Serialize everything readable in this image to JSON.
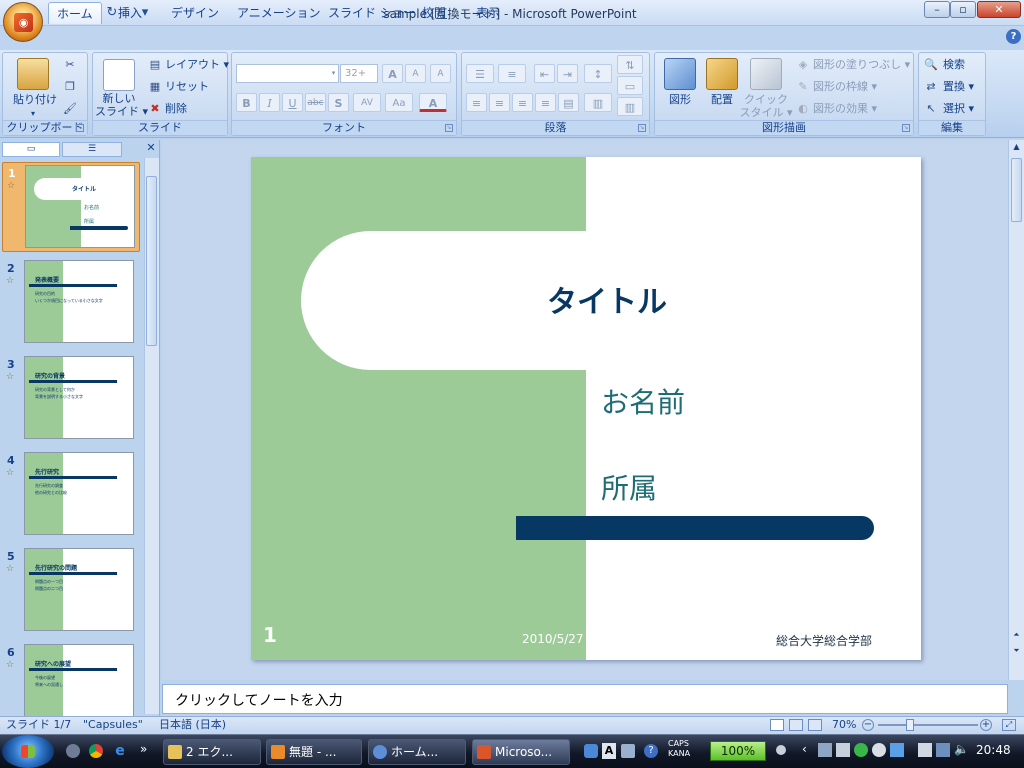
{
  "window": {
    "title": "sample [互換モード] - Microsoft PowerPoint",
    "minimize": "–",
    "maximize": "▫",
    "close": "✕"
  },
  "qat": {
    "save": "💾",
    "undo": "↶",
    "redo": "↻",
    "customize": "▾"
  },
  "tabs": [
    "ホーム",
    "挿入",
    "デザイン",
    "アニメーション",
    "スライド ショー",
    "校閲",
    "表示"
  ],
  "ribbon": {
    "clipboard": {
      "label": "クリップボード",
      "paste": "貼り付け",
      "paste_arrow": "▾"
    },
    "slides": {
      "label": "スライド",
      "new_slide_line1": "新しい",
      "new_slide_line2": "スライド ▾",
      "layout": "レイアウト ▾",
      "reset": "リセット",
      "delete": "削除"
    },
    "font": {
      "label": "フォント",
      "font_name": "",
      "font_size": "32+",
      "bold": "B",
      "italic": "I",
      "underline": "U",
      "strike": "abc",
      "shadow": "S",
      "spacing": "AV",
      "case": "Aa",
      "color": "A",
      "grow": "A",
      "shrink": "A",
      "clear": "A"
    },
    "paragraph": {
      "label": "段落"
    },
    "drawing": {
      "label": "図形描画",
      "shapes": "図形",
      "arrange": "配置",
      "quick_style_line1": "クイック",
      "quick_style_line2": "スタイル ▾",
      "fill": "図形の塗りつぶし ▾",
      "outline": "図形の枠線 ▾",
      "effects": "図形の効果 ▾"
    },
    "editing": {
      "label": "編集",
      "find": "検索",
      "replace": "置換 ▾",
      "select": "選択 ▾"
    }
  },
  "thumbnails": [
    {
      "num": "1",
      "title": "タイトル",
      "l1": "お名前",
      "l2": "所属"
    },
    {
      "num": "2",
      "title": "発表概要",
      "l1": "研究の目的",
      "l2": "いくつか項目になっている小さな文字"
    },
    {
      "num": "3",
      "title": "研究の背景",
      "l1": "研究の背景として何か",
      "l2": "背景を説明する小さな文字"
    },
    {
      "num": "4",
      "title": "先行研究",
      "l1": "先行研究の調査",
      "l2": "他の研究との比較"
    },
    {
      "num": "5",
      "title": "先行研究の問題",
      "l1": "問題点の一つ目",
      "l2": "問題点の二つ目"
    },
    {
      "num": "6",
      "title": "研究への展望",
      "l1": "今後の展望",
      "l2": "将来への見通し"
    }
  ],
  "slide": {
    "title": "タイトル",
    "name": "お名前",
    "affiliation": "所属",
    "number": "1",
    "date": "2010/5/27",
    "footer": "総合大学総合学部",
    "colors": {
      "green": "#9dcb98",
      "navy": "#073864",
      "teal": "#1e6c74"
    }
  },
  "notes": {
    "placeholder": "クリックしてノートを入力"
  },
  "status": {
    "slide_count": "スライド 1/7",
    "theme": "\"Capsules\"",
    "language": "日本語 (日本)",
    "zoom": "70%"
  },
  "taskbar": {
    "tasks": [
      "2 エク...",
      "無題 - ...",
      "ホーム...",
      "Microso..."
    ],
    "battery": "100%",
    "caps": "CAPS",
    "kana": "KANA",
    "clock": "20:48"
  }
}
